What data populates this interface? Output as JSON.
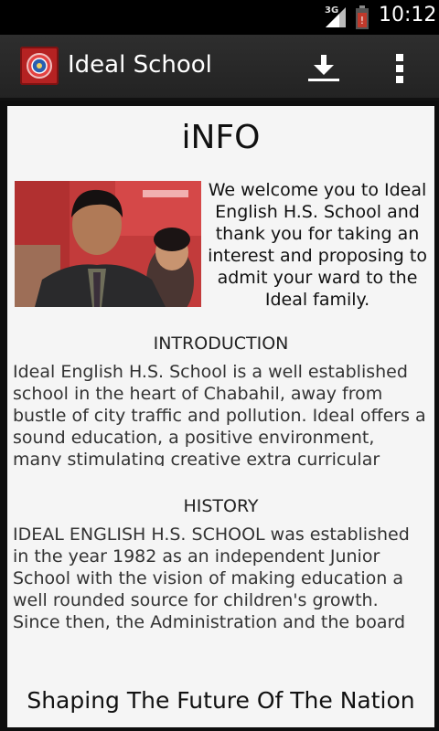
{
  "status_bar": {
    "network_type": "3G",
    "time": "10:12"
  },
  "action_bar": {
    "title": "Ideal School",
    "icons": [
      "app-logo-icon",
      "download-icon",
      "overflow-menu-icon"
    ]
  },
  "content": {
    "heading": "iNFO",
    "welcome": "We welcome you to Ideal English H.S. School and thank you for taking an interest and proposing to admit your ward to the Ideal family.",
    "introduction": {
      "heading": "INTRODUCTION",
      "body": "Ideal English H.S. School is a well established school in the heart of Chabahil, away from bustle of city traffic and pollution. Ideal offers a sound education, a positive environment, many stimulating creative extra curricular resources"
    },
    "history": {
      "heading": "HISTORY",
      "body": "IDEAL ENGLISH H.S. SCHOOL was established in the year 1982 as an independent Junior School with the vision of making education a well rounded source for children's growth. Since then, the Administration and the board of"
    },
    "tagline": "Shaping The Future Of The Nation"
  },
  "colors": {
    "action_bar": "#2b2b2b",
    "app_icon": "#b52222",
    "card": "#f5f5f5"
  }
}
